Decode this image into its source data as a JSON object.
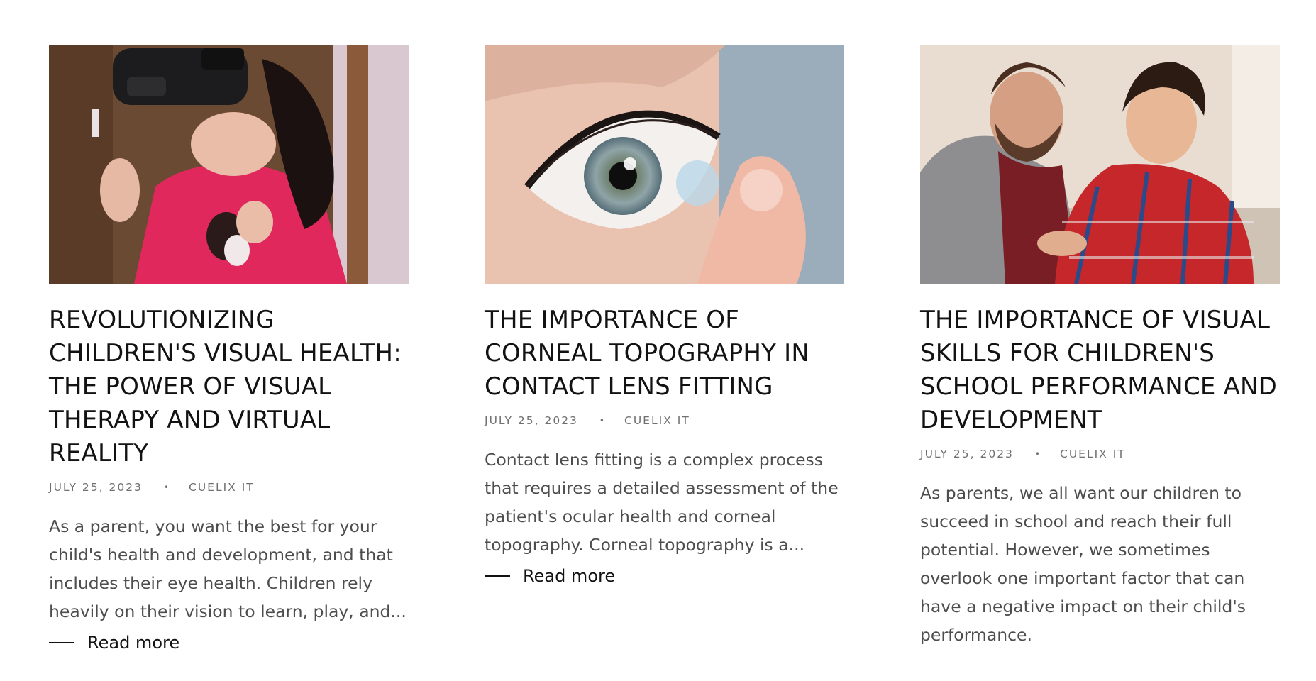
{
  "posts": [
    {
      "title": "REVOLUTIONIZING CHILDREN'S VISUAL HEALTH: THE POWER OF VISUAL THERAPY AND VIRTUAL REALITY",
      "date": "JULY 25, 2023",
      "separator": "•",
      "author": "CUELIX IT",
      "excerpt": "As a parent, you want the best for your child's health and development, and that includes their eye health. Children rely heavily on their vision to learn, play, and...",
      "read_more": "Read more",
      "image_icon": "girl-vr-headset-photo"
    },
    {
      "title": "THE IMPORTANCE OF CORNEAL TOPOGRAPHY IN CONTACT LENS FITTING",
      "date": "JULY 25, 2023",
      "separator": "•",
      "author": "CUELIX IT",
      "excerpt": "Contact lens fitting is a complex process that requires a detailed assessment of the patient's ocular health and corneal topography. Corneal topography is a...",
      "read_more": "Read more",
      "image_icon": "eye-contact-lens-photo"
    },
    {
      "title": "THE IMPORTANCE OF VISUAL SKILLS FOR CHILDREN'S SCHOOL PERFORMANCE AND DEVELOPMENT",
      "date": "JULY 25, 2023",
      "separator": "•",
      "author": "CUELIX IT",
      "excerpt": "As parents, we all want our children to succeed in school and reach their full potential. However, we sometimes overlook one important factor that can have a negative impact on their child's performance.",
      "read_more": "Read more",
      "image_icon": "father-son-homework-photo"
    }
  ]
}
